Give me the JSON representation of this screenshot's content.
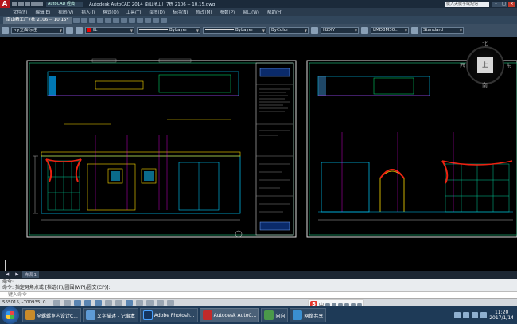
{
  "window": {
    "app_logo": "A",
    "workspace": "AutoCAD 经典",
    "title": "Autodesk AutoCAD 2014   南山精工厂7栋 2106 -- 10.15.dwg",
    "search_placeholder": "键入关键字或短语"
  },
  "menu": [
    "文件(F)",
    "编辑(E)",
    "视图(V)",
    "插入(I)",
    "格式(O)",
    "工具(T)",
    "绘图(D)",
    "标注(N)",
    "修改(M)",
    "参数(P)",
    "窗口(W)",
    "帮助(H)"
  ],
  "doc_tab": "南山精工厂7栋 2106 -- 10.15*",
  "properties": {
    "layer": "-ry立面标注",
    "color": "红",
    "linetype1": "ByLayer",
    "linetype2": "ByLayer",
    "lineweight": "ByColor",
    "textstyle": "HZXY",
    "dimstyle": "LMD8M30...",
    "tablestyle": "Standard"
  },
  "viewcube": {
    "top": "上",
    "n": "北",
    "s": "南",
    "e": "东",
    "w": "西"
  },
  "model_tabs": [
    "布局1"
  ],
  "command": {
    "line1": "命令:",
    "line2": "命令: 指定另角点或 [栏选(F)/圈围(WP)/圈交(CP)]:",
    "placeholder": "键入命令"
  },
  "status": {
    "coords": "565015, -700935, 0"
  },
  "taskbar": {
    "items": [
      {
        "label": "全螺螺室内设计C...",
        "color": "#c98b2a"
      },
      {
        "label": "文字描述 - 记事本",
        "color": "#5e9bd6"
      },
      {
        "label": "Adobe Photosh...",
        "color": "#16365f"
      },
      {
        "label": "Autodesk AutoC...",
        "color": "#c12a2a"
      },
      {
        "label": "向向",
        "color": "#4a9a4a"
      },
      {
        "label": "网络共享",
        "color": "#3a8fd0"
      }
    ],
    "time": "11:20",
    "date": "2017/1/14"
  },
  "ime": {
    "label": "中"
  },
  "colors": {
    "title": "#1b2a3a",
    "accent": "#5b86b3"
  }
}
